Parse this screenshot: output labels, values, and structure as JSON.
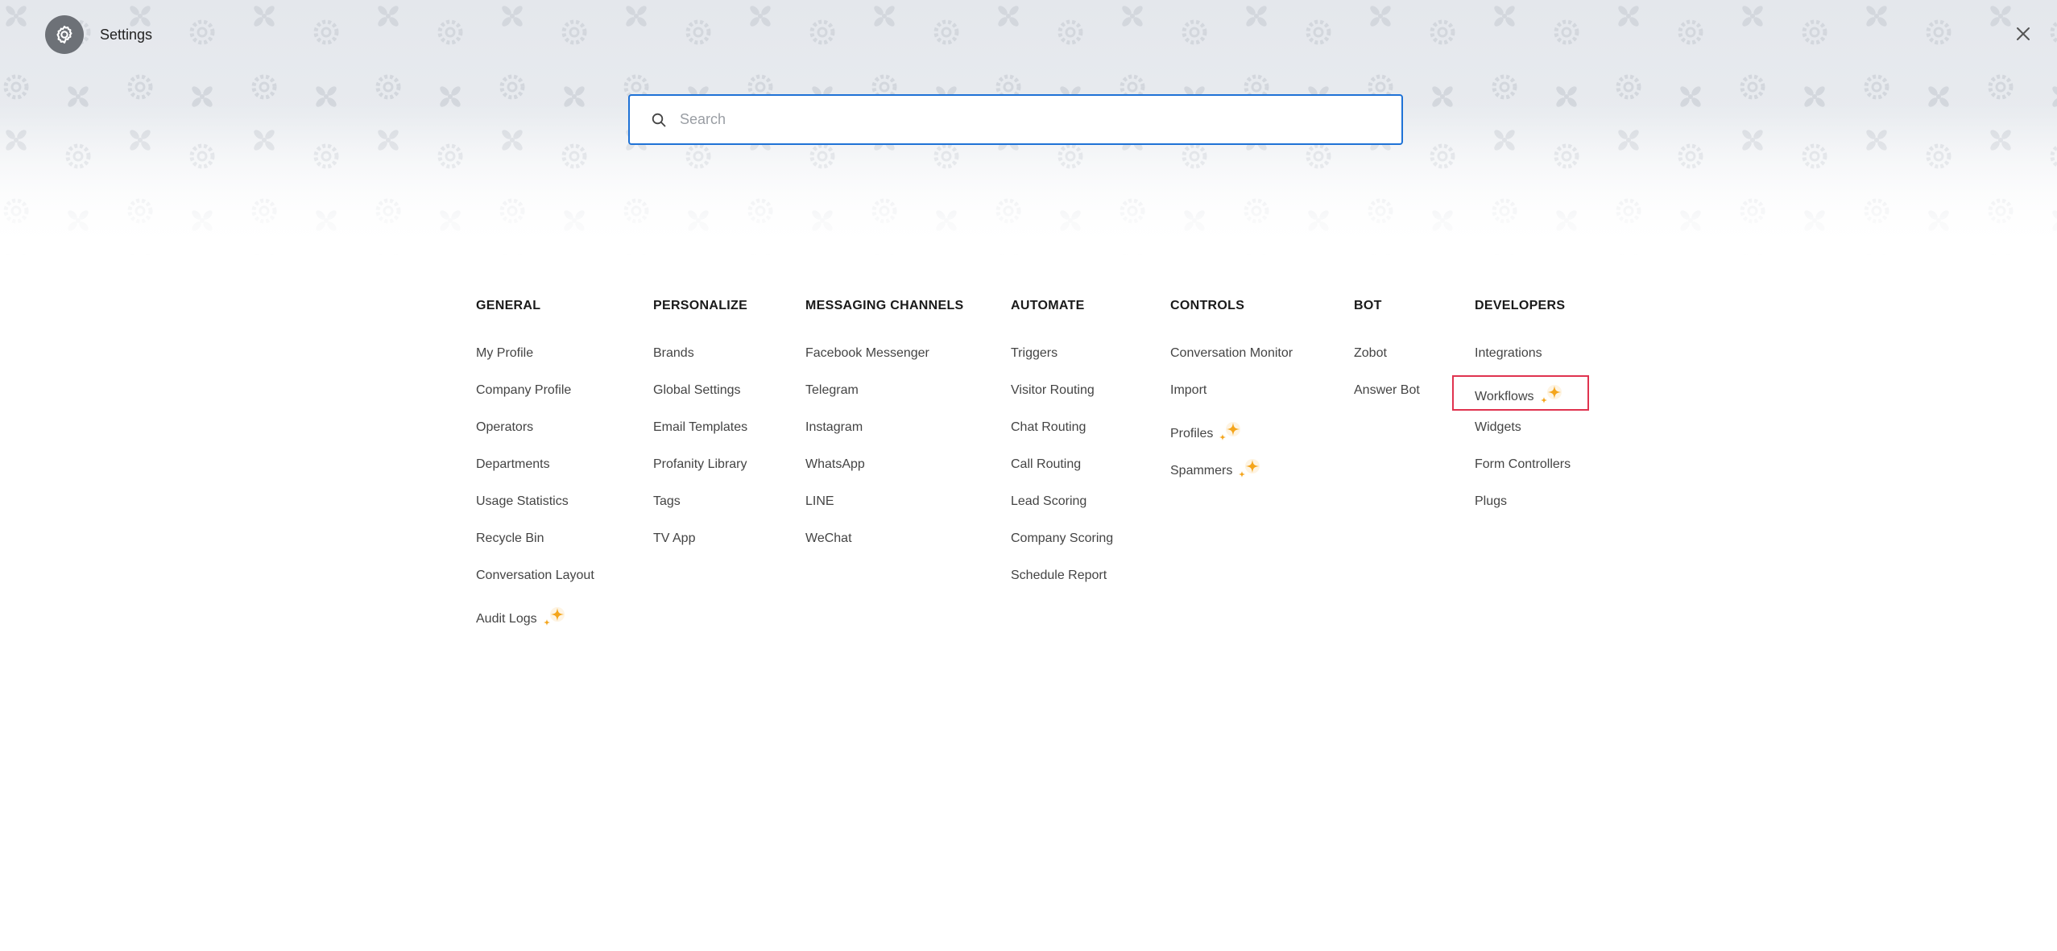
{
  "header": {
    "title": "Settings",
    "settings_icon": "gear-icon",
    "close_icon": "close-icon"
  },
  "search": {
    "placeholder": "Search",
    "value": ""
  },
  "colors": {
    "accent": "#1f72d6",
    "highlight": "#e0334f",
    "sparkle": "#f4a51c"
  },
  "categories": [
    {
      "key": "general",
      "heading": "GENERAL",
      "items": [
        {
          "label": "My Profile",
          "new": false
        },
        {
          "label": "Company Profile",
          "new": false
        },
        {
          "label": "Operators",
          "new": false
        },
        {
          "label": "Departments",
          "new": false
        },
        {
          "label": "Usage Statistics",
          "new": false
        },
        {
          "label": "Recycle Bin",
          "new": false
        },
        {
          "label": "Conversation Layout",
          "new": false
        },
        {
          "label": "Audit Logs",
          "new": true
        }
      ]
    },
    {
      "key": "personalize",
      "heading": "PERSONALIZE",
      "items": [
        {
          "label": "Brands",
          "new": false
        },
        {
          "label": "Global Settings",
          "new": false
        },
        {
          "label": "Email Templates",
          "new": false
        },
        {
          "label": "Profanity Library",
          "new": false
        },
        {
          "label": "Tags",
          "new": false
        },
        {
          "label": "TV App",
          "new": false
        }
      ]
    },
    {
      "key": "messaging-channels",
      "heading": "MESSAGING CHANNELS",
      "items": [
        {
          "label": "Facebook Messenger",
          "new": false
        },
        {
          "label": "Telegram",
          "new": false
        },
        {
          "label": "Instagram",
          "new": false
        },
        {
          "label": "WhatsApp",
          "new": false
        },
        {
          "label": "LINE",
          "new": false
        },
        {
          "label": "WeChat",
          "new": false
        }
      ]
    },
    {
      "key": "automate",
      "heading": "AUTOMATE",
      "items": [
        {
          "label": "Triggers",
          "new": false
        },
        {
          "label": "Visitor Routing",
          "new": false
        },
        {
          "label": "Chat Routing",
          "new": false
        },
        {
          "label": "Call Routing",
          "new": false
        },
        {
          "label": "Lead Scoring",
          "new": false
        },
        {
          "label": "Company Scoring",
          "new": false
        },
        {
          "label": "Schedule Report",
          "new": false
        }
      ]
    },
    {
      "key": "controls",
      "heading": "CONTROLS",
      "items": [
        {
          "label": "Conversation Monitor",
          "new": false
        },
        {
          "label": "Import",
          "new": false
        },
        {
          "label": "Profiles",
          "new": true
        },
        {
          "label": "Spammers",
          "new": true
        }
      ]
    },
    {
      "key": "bot",
      "heading": "BOT",
      "items": [
        {
          "label": "Zobot",
          "new": false
        },
        {
          "label": "Answer Bot",
          "new": false
        }
      ]
    },
    {
      "key": "developers",
      "heading": "DEVELOPERS",
      "items": [
        {
          "label": "Integrations",
          "new": false
        },
        {
          "label": "Workflows",
          "new": true,
          "highlighted": true
        },
        {
          "label": "Widgets",
          "new": false
        },
        {
          "label": "Form Controllers",
          "new": false
        },
        {
          "label": "Plugs",
          "new": false
        }
      ]
    }
  ]
}
